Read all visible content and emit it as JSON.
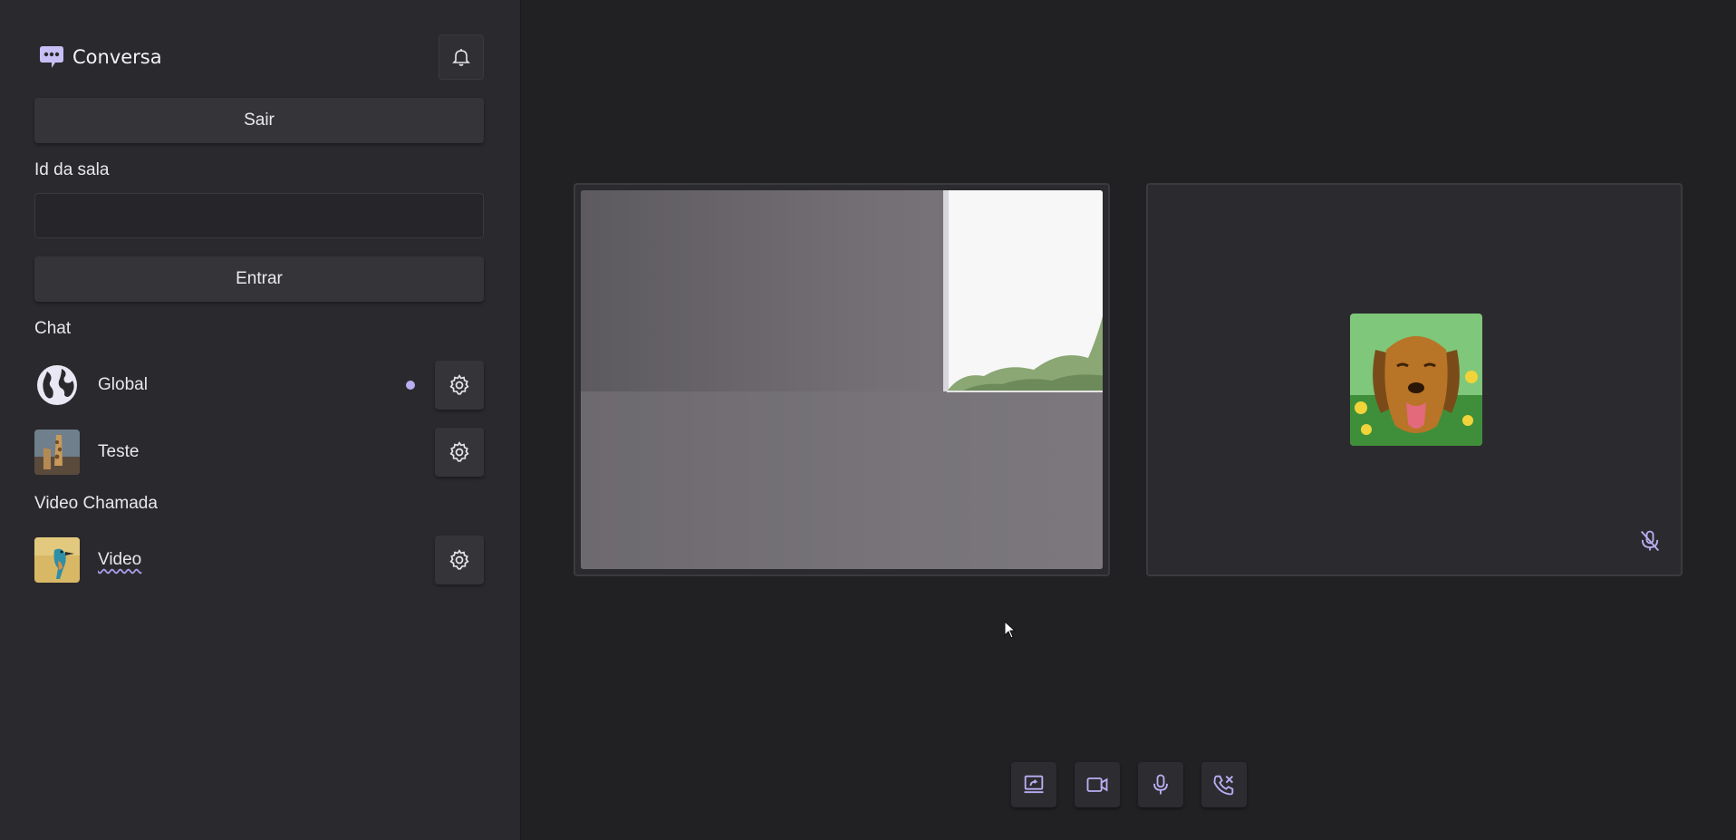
{
  "app": {
    "name": "Conversa",
    "accent": "#b9aef2"
  },
  "sidebar": {
    "logout_label": "Sair",
    "room_id_label": "Id da sala",
    "room_id_value": "",
    "join_label": "Entrar",
    "chat_section_label": "Chat",
    "chats": [
      {
        "name": "Global",
        "icon": "globe-icon",
        "unread": true
      },
      {
        "name": "Teste",
        "icon": "giraffe-photo",
        "unread": false
      }
    ],
    "video_section_label": "Video Chamada",
    "video_rooms": [
      {
        "name": "Video",
        "icon": "kingfisher-photo"
      }
    ]
  },
  "call": {
    "participants": [
      {
        "type": "camera",
        "muted": false
      },
      {
        "type": "avatar",
        "avatar": "dog-photo",
        "muted": true
      }
    ],
    "controls": [
      {
        "name": "share-screen",
        "icon": "screen-share-icon"
      },
      {
        "name": "camera",
        "icon": "video-camera-icon"
      },
      {
        "name": "microphone",
        "icon": "microphone-icon"
      },
      {
        "name": "hang-up",
        "icon": "phone-hangup-icon"
      }
    ]
  }
}
